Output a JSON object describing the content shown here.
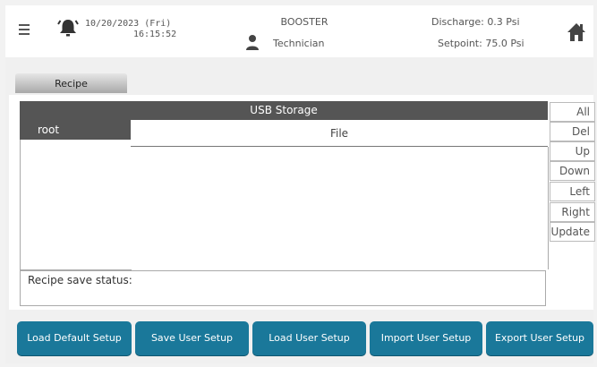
{
  "header": {
    "date": "10/20/2023 (Fri)",
    "time": "16:15:52",
    "mode": "BOOSTER",
    "user": "Technician",
    "discharge_label": "Discharge:",
    "discharge_value": "0.3 Psi",
    "setpoint_label": "Setpoint:",
    "setpoint_value": "75.0 Psi"
  },
  "tabs": [
    {
      "label": "Recipe"
    }
  ],
  "storage": {
    "title": "USB Storage",
    "directories": [
      "root"
    ],
    "file_column": "File",
    "files": []
  },
  "side_buttons": [
    "All",
    "Del",
    "Up",
    "Down",
    "Left",
    "Right",
    "Update"
  ],
  "status": {
    "label": "Recipe save status:",
    "value": ""
  },
  "bottom_buttons": [
    "Load Default Setup",
    "Save User Setup",
    "Load User Setup",
    "Import User  Setup",
    "Export User Setup"
  ],
  "colors": {
    "accent": "#1a789a",
    "header_bar": "#555555",
    "alarm_icon": "#333333"
  }
}
